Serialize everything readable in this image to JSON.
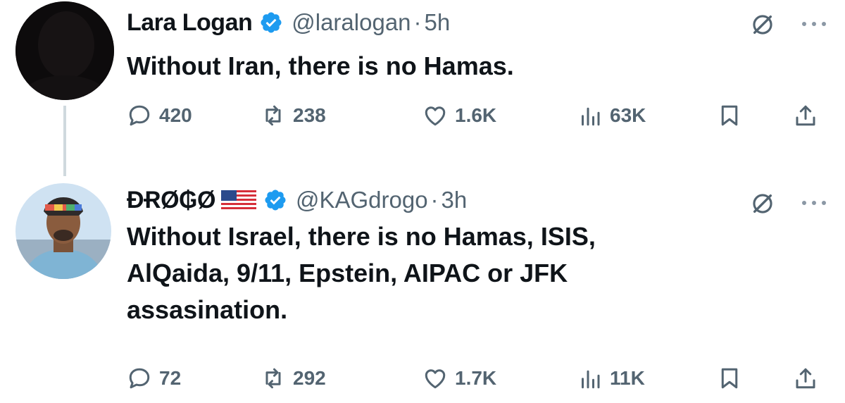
{
  "tweets": [
    {
      "name": "Lara Logan",
      "handle": "@laralogan",
      "separator": "·",
      "time": "5h",
      "text": "Without Iran, there is no Hamas.",
      "stats": {
        "replies": "420",
        "retweets": "238",
        "likes": "1.6K",
        "views": "63K"
      }
    },
    {
      "name": "ĐɌØ₲Ø",
      "handle": "@KAGdrogo",
      "separator": "·",
      "time": "3h",
      "text": "Without Israel, there is no Hamas, ISIS,\nAlQaida, 9/11, Epstein, AIPAC or JFK\nassasination.",
      "stats": {
        "replies": "72",
        "retweets": "292",
        "likes": "1.7K",
        "views": "11K"
      }
    }
  ],
  "colors": {
    "verified": "#1d9bf0",
    "muted": "#536471",
    "text": "#0f1419",
    "thread_line": "#cfd9de"
  },
  "icons": [
    "verified-badge-icon",
    "us-flag-icon",
    "grok-icon",
    "more-icon",
    "reply-icon",
    "retweet-icon",
    "like-icon",
    "views-icon",
    "bookmark-icon",
    "share-icon"
  ]
}
